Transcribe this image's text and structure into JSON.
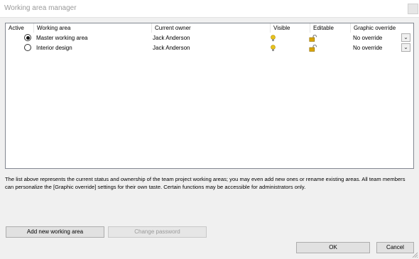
{
  "window": {
    "title": "Working area manager"
  },
  "table": {
    "headers": {
      "active": "Active",
      "working_area": "Working area",
      "current_owner": "Current owner",
      "visible": "Visible",
      "editable": "Editable",
      "graphic_override": "Graphic override"
    },
    "rows": [
      {
        "active": true,
        "working_area": "Master working area",
        "current_owner": "Jack Anderson",
        "visible_icon": "lightbulb-icon",
        "editable_icon": "unlocked-padlock-icon",
        "graphic_override": "No override"
      },
      {
        "active": false,
        "working_area": "Interior design",
        "current_owner": "Jack Anderson",
        "visible_icon": "lightbulb-icon",
        "editable_icon": "unlocked-padlock-icon",
        "graphic_override": "No override"
      }
    ]
  },
  "description": "The list above represents the current status and ownership of the team project working areas; you may even add new ones or rename existing areas. All team members can personalize the [Graphic override] settings for their own taste. Certain functions may be accessible for administrators only.",
  "buttons": {
    "add": "Add new working area",
    "change_password": "Change password",
    "ok": "OK",
    "cancel": "Cancel"
  },
  "colors": {
    "bulb": "#e8c21c",
    "lock": "#d9a400",
    "border": "#828790"
  }
}
